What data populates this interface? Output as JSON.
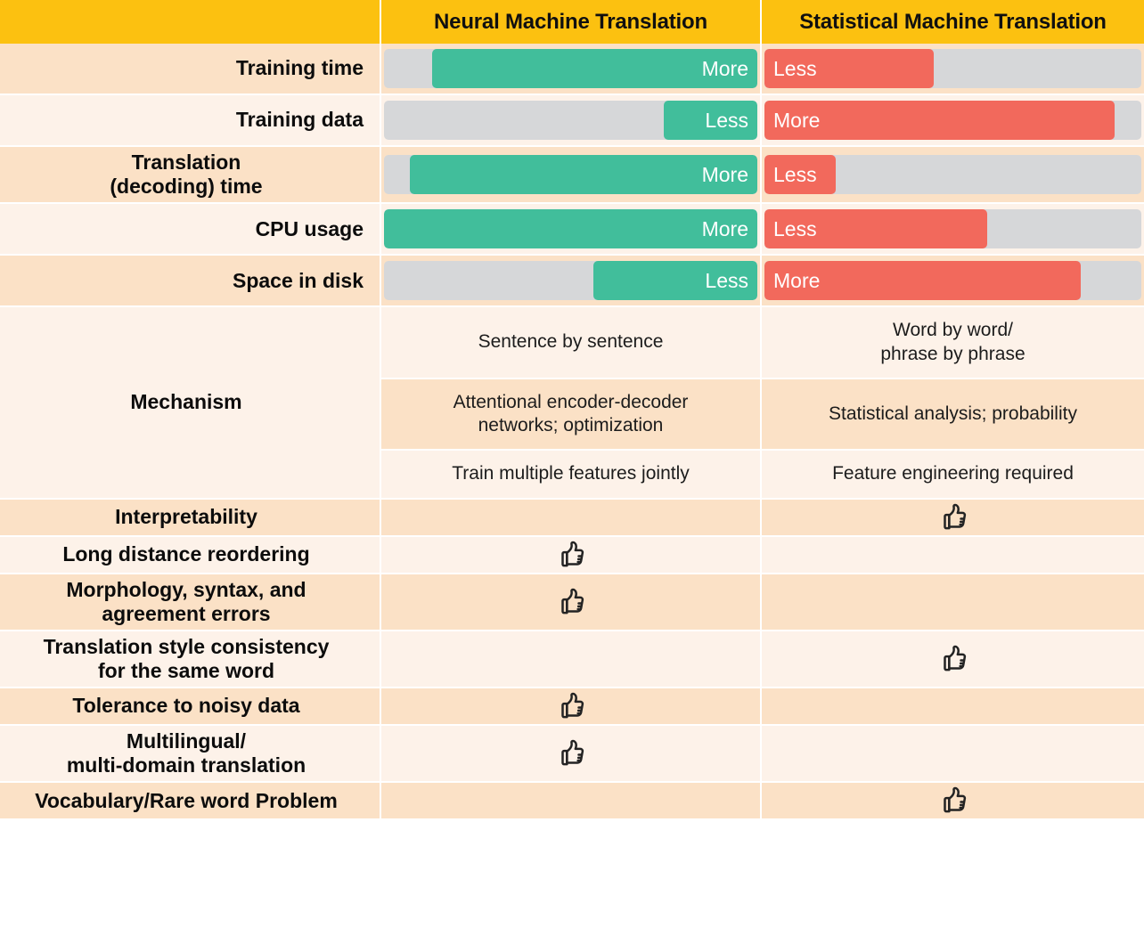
{
  "header": {
    "corner_label": "",
    "col_nmt": "Neural Machine Translation",
    "col_smt": "Statistical Machine Translation"
  },
  "colors": {
    "header_bg": "#FCC110",
    "row_peach": "#FBE1C6",
    "row_light": "#FDF2E9",
    "bar_track": "#D6D7D9",
    "bar_green": "#41BE9B",
    "bar_red": "#F2695C",
    "text_dark": "#0C0C0C",
    "bar_text": "#FFFFFF"
  },
  "bar_rows": [
    {
      "label": "Training time",
      "nmt": {
        "value_label": "More",
        "fill_pct": 87
      },
      "smt": {
        "value_label": "Less",
        "fill_pct": 45
      }
    },
    {
      "label": "Training data",
      "nmt": {
        "value_label": "Less",
        "fill_pct": 25
      },
      "smt": {
        "value_label": "More",
        "fill_pct": 93
      }
    },
    {
      "label": "Translation\n(decoding) time",
      "label_line1": "Translation",
      "label_line2": "(decoding) time",
      "nmt": {
        "value_label": "More",
        "fill_pct": 93
      },
      "smt": {
        "value_label": "Less",
        "fill_pct": 19
      }
    },
    {
      "label": "CPU usage",
      "nmt": {
        "value_label": "More",
        "fill_pct": 100
      },
      "smt": {
        "value_label": "Less",
        "fill_pct": 59
      }
    },
    {
      "label": "Space in disk",
      "nmt": {
        "value_label": "Less",
        "fill_pct": 44
      },
      "smt": {
        "value_label": "More",
        "fill_pct": 84
      }
    }
  ],
  "mechanism": {
    "label": "Mechanism",
    "rows": [
      {
        "nmt": "Sentence by sentence",
        "smt_line1": "Word by word/",
        "smt_line2": "phrase by phrase"
      },
      {
        "nmt_line1": "Attentional encoder-decoder",
        "nmt_line2": "networks; optimization",
        "smt": "Statistical analysis; probability"
      },
      {
        "nmt": "Train multiple features jointly",
        "smt": "Feature engineering required"
      }
    ]
  },
  "thumb_rows": [
    {
      "label": "Interpretability",
      "nmt_thumb": false,
      "smt_thumb": true
    },
    {
      "label": "Long distance reordering",
      "nmt_thumb": true,
      "smt_thumb": false
    },
    {
      "label_line1": "Morphology, syntax, and",
      "label_line2": "agreement errors",
      "nmt_thumb": true,
      "smt_thumb": false
    },
    {
      "label_line1": "Translation style consistency",
      "label_line2": "for the same word",
      "nmt_thumb": false,
      "smt_thumb": true
    },
    {
      "label": "Tolerance to noisy data",
      "nmt_thumb": true,
      "smt_thumb": false
    },
    {
      "label_line1": "Multilingual/",
      "label_line2": "multi-domain translation",
      "nmt_thumb": true,
      "smt_thumb": false
    },
    {
      "label": "Vocabulary/Rare word Problem",
      "nmt_thumb": false,
      "smt_thumb": true
    }
  ],
  "icons": {
    "thumbs_up": "thumbs-up-icon"
  }
}
